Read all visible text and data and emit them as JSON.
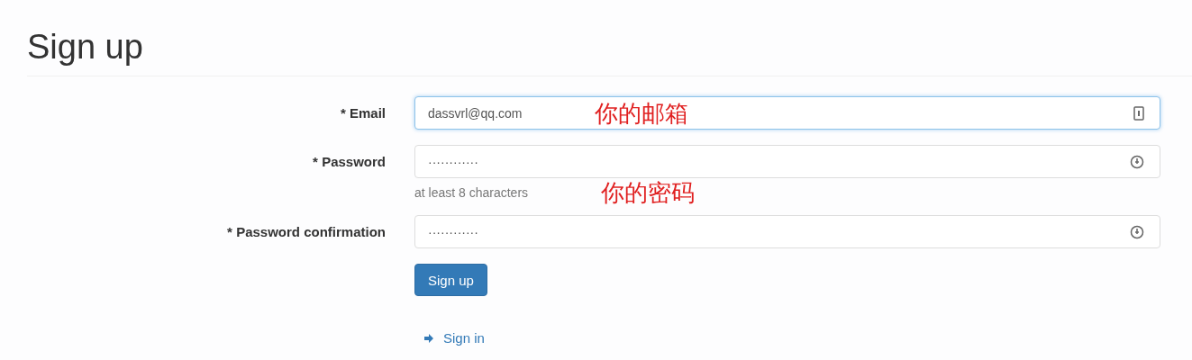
{
  "title": "Sign up",
  "fields": [
    {
      "mark": "*",
      "label": "Email",
      "value": "dassvrl@qq.com",
      "focused": true,
      "kind": "email",
      "annotation": "你的邮箱"
    },
    {
      "mark": "*",
      "label": "Password",
      "value": "············",
      "focused": false,
      "kind": "password",
      "help": "at least 8 characters",
      "annotation": "你的密码"
    },
    {
      "mark": "*",
      "label": "Password confirmation",
      "value": "············",
      "focused": false,
      "kind": "password"
    }
  ],
  "submit": "Sign up",
  "links": [
    {
      "label": "Sign in"
    }
  ]
}
